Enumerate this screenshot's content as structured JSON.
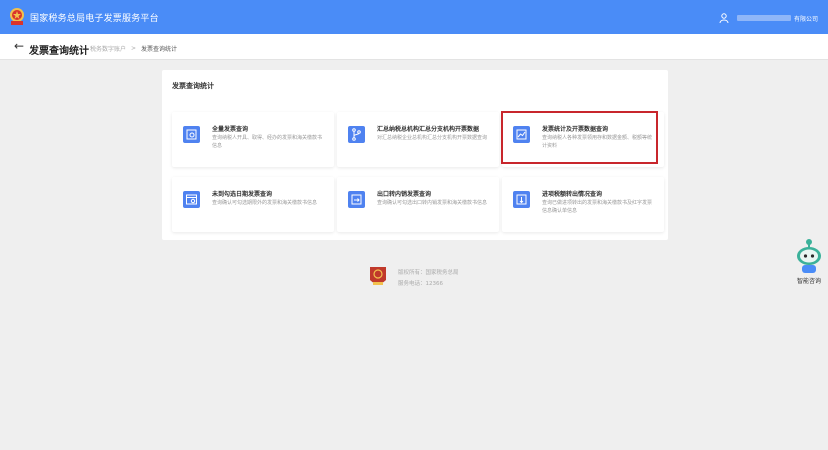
{
  "header": {
    "app_title": "国家税务总局电子发票服务平台",
    "user_name": "有限公司",
    "user_name_masked": true
  },
  "subheader": {
    "title": "发票查询统计",
    "breadcrumb": [
      "税务数字账户",
      "发票查询统计"
    ]
  },
  "panel": {
    "title": "发票查询统计",
    "cards": [
      {
        "title": "全量发票查询",
        "desc": "查询纳税人开具、取得、经办的发票和海关缴款书信息",
        "icon": "search-doc-icon"
      },
      {
        "title": "汇总纳税总机构汇总分支机构开票数据",
        "desc": "对汇总纳税企业总机构汇总分支机构开票数据查询",
        "icon": "branch-icon"
      },
      {
        "title": "发票统计及开票数据查询",
        "desc": "查询纳税人各种发票领用存和数据金额、税额等统计资料",
        "icon": "chart-icon",
        "highlighted": true
      },
      {
        "title": "未到勾选日期发票查询",
        "desc": "查询确认可勾选期限外的发票和海关缴款书信息",
        "icon": "calendar-search-icon"
      },
      {
        "title": "出口转内销发票查询",
        "desc": "查询确认可勾选出口转内销发票和海关缴款书信息",
        "icon": "transfer-icon"
      },
      {
        "title": "进项税额转出情况查询",
        "desc": "查询已做进项转出的发票和海关缴款书及红字发票信息确认单信息",
        "icon": "transfer-out-icon"
      }
    ]
  },
  "footer": {
    "copyright": "版权所有：国家税务总局",
    "service_hotline": "服务电话：12366"
  },
  "assistant": {
    "label": "智能咨询"
  },
  "colors": {
    "header_bg": "#4a8cf7",
    "icon_bg": "#4f82f0",
    "highlight_border": "#c8262c",
    "page_bg": "#efefef"
  }
}
